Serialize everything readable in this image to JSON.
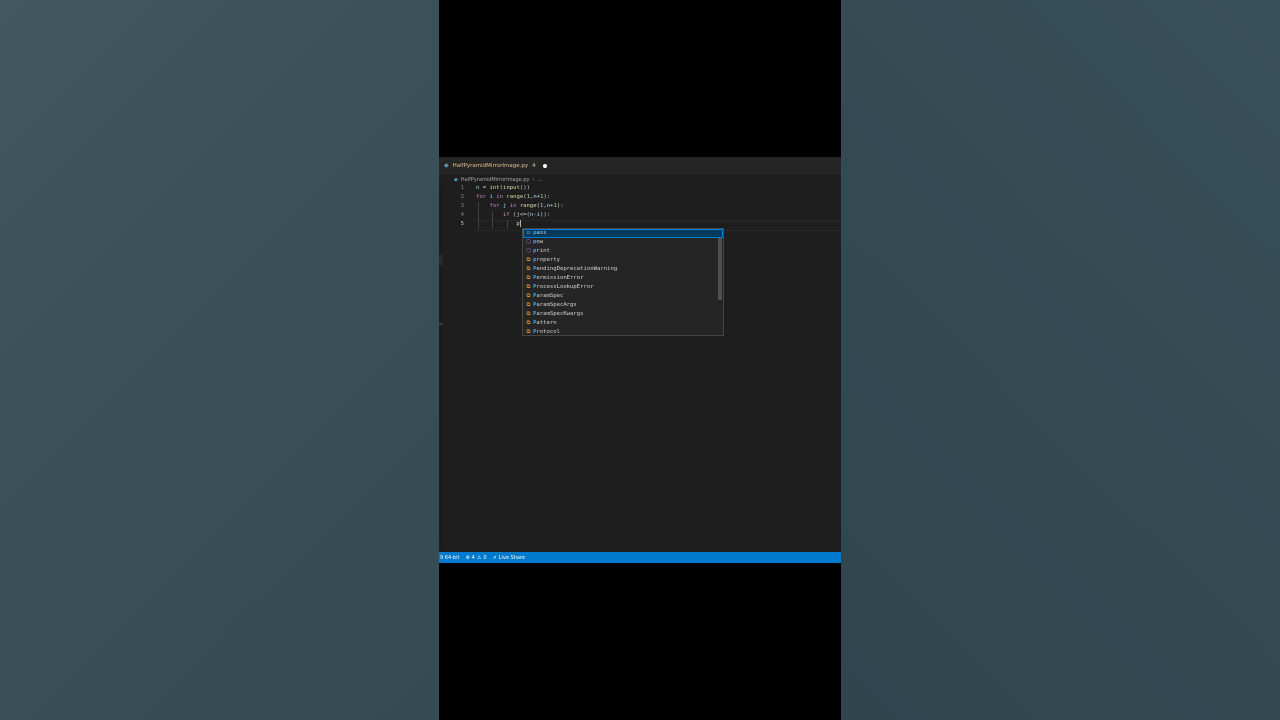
{
  "editor": {
    "tab": {
      "filename": "HalfPyramidMirrorImage.py",
      "problem_count": "4"
    },
    "breadcrumb": {
      "file": "HalfPyramidMirrorImage.py",
      "separator": "›",
      "trail": "..."
    },
    "lines": [
      {
        "number": "1",
        "parts": [
          {
            "t": "n ",
            "c": "var"
          },
          {
            "t": "= ",
            "c": "plain"
          },
          {
            "t": "int",
            "c": "fn"
          },
          {
            "t": "(",
            "c": "plain"
          },
          {
            "t": "input",
            "c": "fn"
          },
          {
            "t": "())",
            "c": "plain"
          }
        ]
      },
      {
        "number": "2",
        "parts": [
          {
            "t": "for ",
            "c": "kw"
          },
          {
            "t": "i ",
            "c": "var"
          },
          {
            "t": "in ",
            "c": "kw"
          },
          {
            "t": "range",
            "c": "fn"
          },
          {
            "t": "(",
            "c": "plain"
          },
          {
            "t": "1",
            "c": "num"
          },
          {
            "t": ",",
            "c": "plain"
          },
          {
            "t": "n",
            "c": "var"
          },
          {
            "t": "+",
            "c": "plain"
          },
          {
            "t": "1",
            "c": "num"
          },
          {
            "t": "):",
            "c": "plain"
          }
        ]
      },
      {
        "number": "3",
        "parts": [
          {
            "t": "    for ",
            "c": "kw"
          },
          {
            "t": "j ",
            "c": "var"
          },
          {
            "t": "in ",
            "c": "kw"
          },
          {
            "t": "range",
            "c": "fn"
          },
          {
            "t": "(",
            "c": "plain"
          },
          {
            "t": "1",
            "c": "num"
          },
          {
            "t": ",",
            "c": "plain"
          },
          {
            "t": "n",
            "c": "var"
          },
          {
            "t": "+",
            "c": "plain"
          },
          {
            "t": "1",
            "c": "num"
          },
          {
            "t": "):",
            "c": "plain"
          }
        ]
      },
      {
        "number": "4",
        "parts": [
          {
            "t": "        if ",
            "c": "kw"
          },
          {
            "t": "(",
            "c": "plain"
          },
          {
            "t": "j",
            "c": "var"
          },
          {
            "t": "<=(",
            "c": "plain"
          },
          {
            "t": "n",
            "c": "var"
          },
          {
            "t": "-",
            "c": "plain"
          },
          {
            "t": "i",
            "c": "var"
          },
          {
            "t": ")):",
            "c": "plain"
          }
        ]
      },
      {
        "number": "5",
        "parts": [
          {
            "t": "            p",
            "c": "plain"
          }
        ]
      }
    ]
  },
  "suggestions": {
    "typed": "p",
    "items": [
      {
        "label": "pass",
        "kind": "keyword",
        "icon": "keyword-icon"
      },
      {
        "label": "pow",
        "kind": "method",
        "icon": "method-icon"
      },
      {
        "label": "print",
        "kind": "method",
        "icon": "method-icon"
      },
      {
        "label": "property",
        "kind": "class",
        "icon": "class-icon"
      },
      {
        "label": "PendingDeprecationWarning",
        "kind": "class",
        "icon": "class-icon"
      },
      {
        "label": "PermissionError",
        "kind": "class",
        "icon": "class-icon"
      },
      {
        "label": "ProcessLookupError",
        "kind": "class",
        "icon": "class-icon"
      },
      {
        "label": "ParamSpec",
        "kind": "class",
        "icon": "class-icon"
      },
      {
        "label": "ParamSpecArgs",
        "kind": "class",
        "icon": "class-icon"
      },
      {
        "label": "ParamSpecKwargs",
        "kind": "class",
        "icon": "class-icon"
      },
      {
        "label": "Pattern",
        "kind": "class",
        "icon": "class-icon"
      },
      {
        "label": "Protocol",
        "kind": "class",
        "icon": "class-icon"
      }
    ]
  },
  "statusbar": {
    "interpreter": "9 64-bit",
    "errors": "4",
    "warnings": "0",
    "live_share": "Live Share"
  },
  "colors": {
    "statusbar": "#007acc",
    "editor_bg": "#1e1e1e",
    "selection": "#04395e",
    "modified_tab": "#e2c08d"
  }
}
